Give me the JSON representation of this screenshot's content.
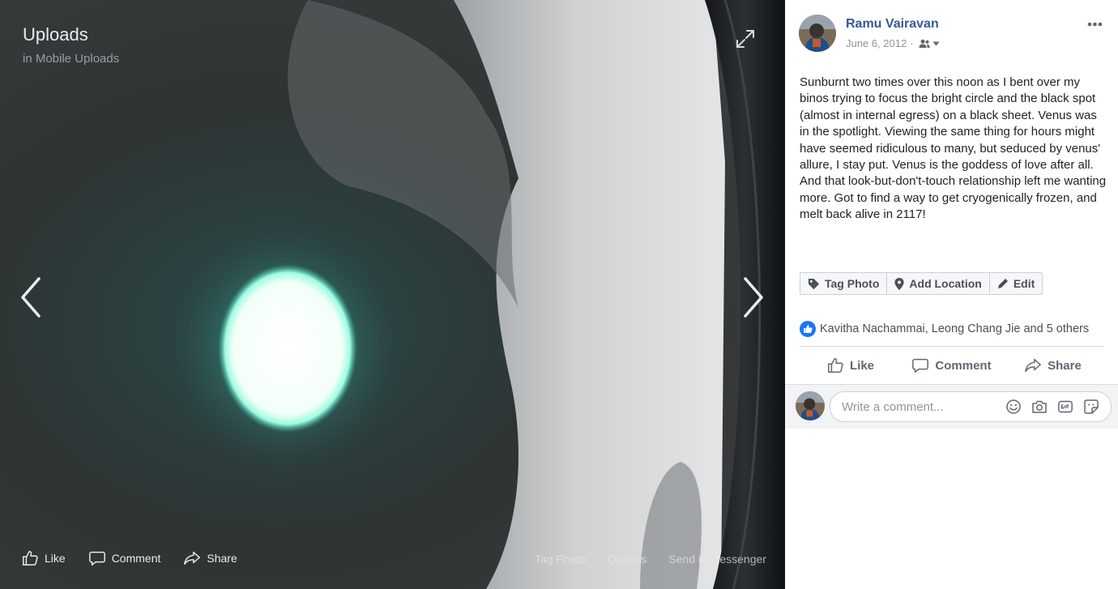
{
  "album": {
    "title": "Uploads",
    "subtitle": "in Mobile Uploads"
  },
  "stage_actions": {
    "like": "Like",
    "comment": "Comment",
    "share": "Share"
  },
  "stage_links": {
    "tag_photo": "Tag Photo",
    "options": "Options",
    "send_in_messenger": "Send in Messenger"
  },
  "post": {
    "author": "Ramu Vairavan",
    "date": "June 6, 2012",
    "separator": "·",
    "audience_icon": "friends-icon",
    "caption": "Sunburnt two times over this noon as I bent over my binos trying to focus the bright circle and the black spot (almost in internal egress) on a black sheet. Venus was in the spotlight. Viewing the same thing for hours might have seemed ridiculous to many, but seduced by venus' allure, I stay put. Venus is the goddess of love after all. And that look-but-don't-touch relationship left me wanting more. Got to find a way to get cryogenically frozen, and melt back alive in 2117!"
  },
  "photo_tools": {
    "tag_photo": "Tag Photo",
    "add_location": "Add Location",
    "edit": "Edit"
  },
  "reactions": {
    "text": "Kavitha Nachammai, Leong Chang Jie and 5 others"
  },
  "actions": {
    "like": "Like",
    "comment": "Comment",
    "share": "Share"
  },
  "comment": {
    "placeholder": "Write a comment..."
  },
  "colors": {
    "link_blue": "#365899",
    "like_blue": "#1877f2",
    "text_dark": "#1d2129",
    "meta_gray": "#90949c"
  }
}
